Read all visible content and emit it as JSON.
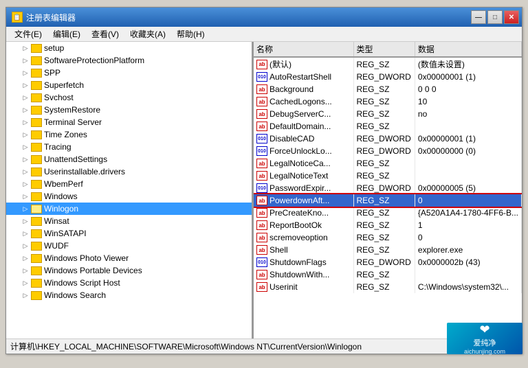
{
  "window": {
    "title": "注册表编辑器",
    "title_icon": "📋",
    "buttons": {
      "minimize": "—",
      "maximize": "□",
      "close": "✕"
    }
  },
  "menubar": {
    "items": [
      {
        "label": "文件(E)",
        "id": "file"
      },
      {
        "label": "编辑(E)",
        "id": "edit"
      },
      {
        "label": "查看(V)",
        "id": "view"
      },
      {
        "label": "收藏夹(A)",
        "id": "favorites"
      },
      {
        "label": "帮助(H)",
        "id": "help"
      }
    ]
  },
  "tree": {
    "items": [
      {
        "label": "setup",
        "indent": 1,
        "has_expander": true
      },
      {
        "label": "SoftwareProtectionPlatform",
        "indent": 1,
        "has_expander": true
      },
      {
        "label": "SPP",
        "indent": 1,
        "has_expander": true
      },
      {
        "label": "Superfetch",
        "indent": 1,
        "has_expander": true
      },
      {
        "label": "Svchost",
        "indent": 1,
        "has_expander": true
      },
      {
        "label": "SystemRestore",
        "indent": 1,
        "has_expander": true
      },
      {
        "label": "Terminal Server",
        "indent": 1,
        "has_expander": true
      },
      {
        "label": "Time Zones",
        "indent": 1,
        "has_expander": true
      },
      {
        "label": "Tracing",
        "indent": 1,
        "has_expander": true
      },
      {
        "label": "UnattendSettings",
        "indent": 1,
        "has_expander": true
      },
      {
        "label": "Userinstallable.drivers",
        "indent": 1,
        "has_expander": true
      },
      {
        "label": "WbemPerf",
        "indent": 1,
        "has_expander": true
      },
      {
        "label": "Windows",
        "indent": 1,
        "has_expander": true
      },
      {
        "label": "Winlogon",
        "indent": 1,
        "has_expander": false,
        "selected": true
      },
      {
        "label": "Winsat",
        "indent": 1,
        "has_expander": true
      },
      {
        "label": "WinSATAPI",
        "indent": 1,
        "has_expander": true
      },
      {
        "label": "WUDF",
        "indent": 1,
        "has_expander": true
      },
      {
        "label": "Windows Photo Viewer",
        "indent": 1,
        "has_expander": true
      },
      {
        "label": "Windows Portable Devices",
        "indent": 1,
        "has_expander": true
      },
      {
        "label": "Windows Script Host",
        "indent": 1,
        "has_expander": true
      },
      {
        "label": "Windows Search",
        "indent": 1,
        "has_expander": true
      }
    ]
  },
  "table": {
    "headers": [
      "名称",
      "类型",
      "数据"
    ],
    "rows": [
      {
        "icon_type": "ab",
        "name": "(默认)",
        "type": "REG_SZ",
        "data": "(数值未设置)",
        "selected": false
      },
      {
        "icon_type": "dword",
        "name": "AutoRestartShell",
        "type": "REG_DWORD",
        "data": "0x00000001 (1)",
        "selected": false
      },
      {
        "icon_type": "ab",
        "name": "Background",
        "type": "REG_SZ",
        "data": "0 0 0",
        "selected": false
      },
      {
        "icon_type": "ab",
        "name": "CachedLogons...",
        "type": "REG_SZ",
        "data": "10",
        "selected": false
      },
      {
        "icon_type": "ab",
        "name": "DebugServerC...",
        "type": "REG_SZ",
        "data": "no",
        "selected": false
      },
      {
        "icon_type": "ab",
        "name": "DefaultDomain...",
        "type": "REG_SZ",
        "data": "",
        "selected": false
      },
      {
        "icon_type": "dword",
        "name": "DisableCAD",
        "type": "REG_DWORD",
        "data": "0x00000001 (1)",
        "selected": false
      },
      {
        "icon_type": "dword",
        "name": "ForceUnlockLo...",
        "type": "REG_DWORD",
        "data": "0x00000000 (0)",
        "selected": false
      },
      {
        "icon_type": "ab",
        "name": "LegalNoticeCa...",
        "type": "REG_SZ",
        "data": "",
        "selected": false
      },
      {
        "icon_type": "ab",
        "name": "LegalNoticeText",
        "type": "REG_SZ",
        "data": "",
        "selected": false
      },
      {
        "icon_type": "dword",
        "name": "PasswordExpir...",
        "type": "REG_DWORD",
        "data": "0x00000005 (5)",
        "selected": false
      },
      {
        "icon_type": "ab",
        "name": "PowerdownAft...",
        "type": "REG_SZ",
        "data": "0",
        "selected": true,
        "red_border": true
      },
      {
        "icon_type": "ab",
        "name": "PreCreateKno...",
        "type": "REG_SZ",
        "data": "{A520A1A4-1780-4FF6-B...",
        "selected": false
      },
      {
        "icon_type": "ab",
        "name": "ReportBootOk",
        "type": "REG_SZ",
        "data": "1",
        "selected": false
      },
      {
        "icon_type": "ab",
        "name": "scremoveoption",
        "type": "REG_SZ",
        "data": "0",
        "selected": false
      },
      {
        "icon_type": "ab",
        "name": "Shell",
        "type": "REG_SZ",
        "data": "explorer.exe",
        "selected": false
      },
      {
        "icon_type": "dword",
        "name": "ShutdownFlags",
        "type": "REG_DWORD",
        "data": "0x0000002b (43)",
        "selected": false
      },
      {
        "icon_type": "ab",
        "name": "ShutdownWith...",
        "type": "REG_SZ",
        "data": "",
        "selected": false
      },
      {
        "icon_type": "ab",
        "name": "Userinit",
        "type": "REG_SZ",
        "data": "C:\\Windows\\system32\\...",
        "selected": false
      }
    ]
  },
  "statusbar": {
    "path": "计算机\\HKEY_LOCAL_MACHINE\\SOFTWARE\\Microsoft\\Windows NT\\CurrentVersion\\Winlogon"
  },
  "watermark": {
    "text": "爱纯净",
    "subtext": "aichunjing.com"
  }
}
